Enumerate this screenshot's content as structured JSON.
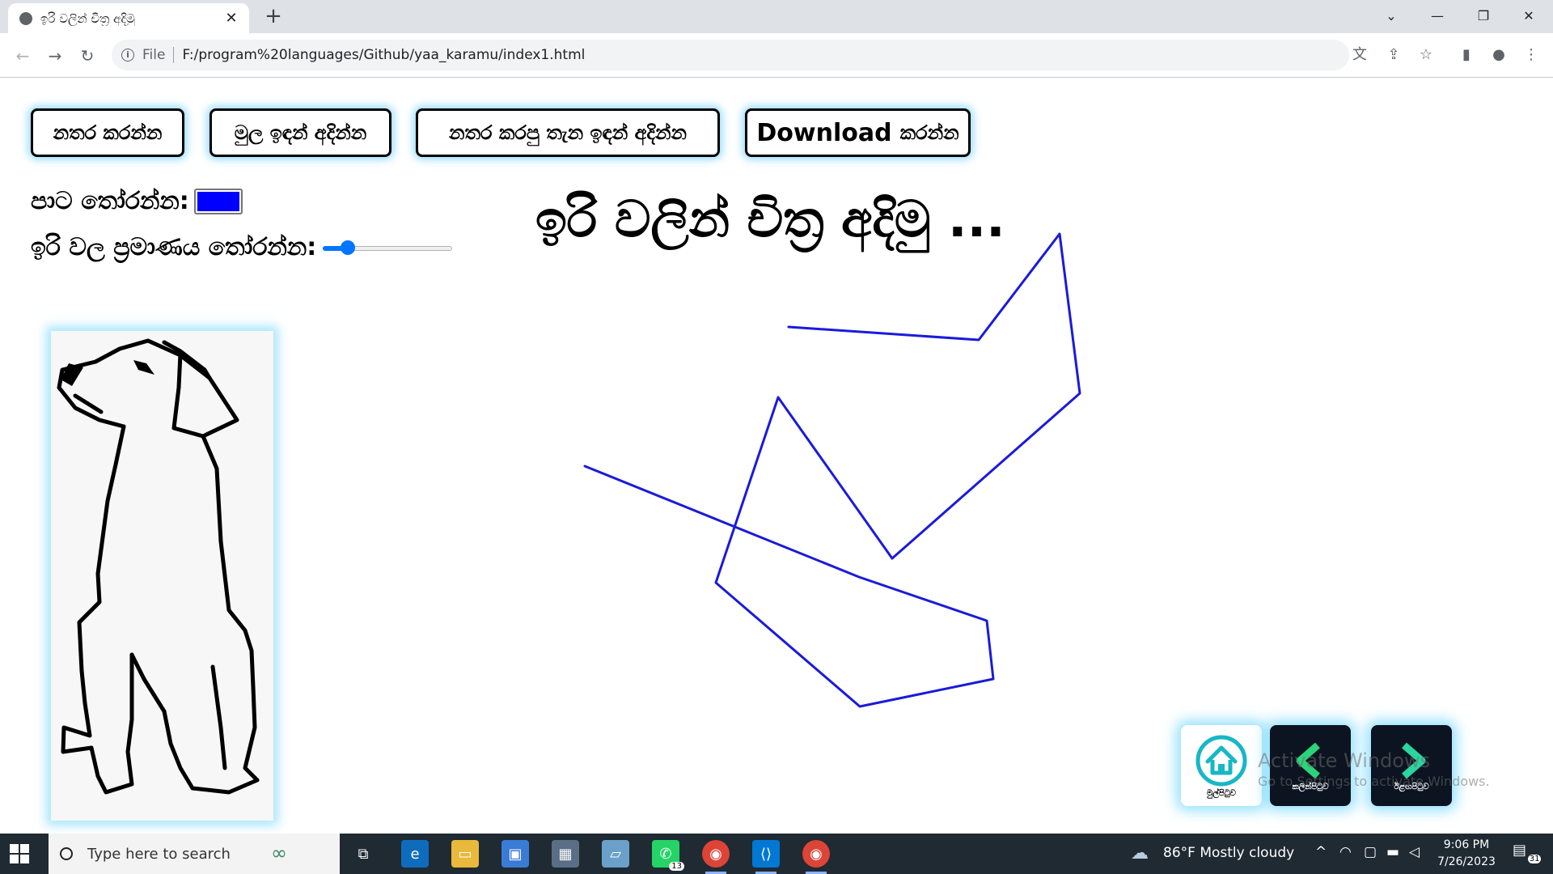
{
  "browser": {
    "tab_title": "ඉරි වලින් චිත්‍ර අදිමු",
    "new_tab": "+",
    "file_label": "File",
    "url": "F:/program%20languages/Github/yaa_karamu/index1.html"
  },
  "page": {
    "buttons": {
      "stop": "නතර කරන්න",
      "original": "මුල ඉඳන් අදින්න",
      "from_stopped": "නතර කරපු තැන ඉඳන් අදින්න",
      "download_word": "Download",
      "download_rest": "කරන්න"
    },
    "color_label": "පාට තෝරන්න:",
    "color_value": "#0000ff",
    "size_label": "ඉරි වල ප්‍රමාණය තෝරන්න:",
    "size_slider": {
      "min": 0,
      "max": 100,
      "value": 15
    },
    "heading": "ඉරි වලින් චිත්‍ර අදිමු ...",
    "line_color": "#1a1adb",
    "nav": {
      "home_caption": "මුල්පිටුව",
      "back_caption": "කලින්පිටුව",
      "forward_caption": "ඊළඟපිටුව"
    },
    "watermark": {
      "line1": "Activate Windows",
      "line2": "Go to Settings to activate Windows."
    }
  },
  "taskbar": {
    "search_placeholder": "Type here to search",
    "chat_badge": "13",
    "weather": "86°F  Mostly cloudy",
    "time": "9:06 PM",
    "date": "7/26/2023",
    "notifications": "31"
  }
}
